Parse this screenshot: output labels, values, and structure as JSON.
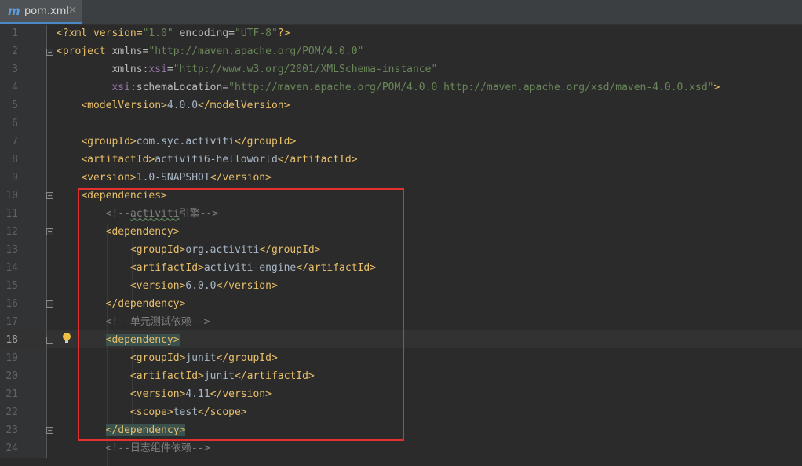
{
  "tab": {
    "icon": "m",
    "filename": "pom.xml",
    "close": "✕"
  },
  "accent_colors": {
    "tag": "#e8bf6a",
    "attribute_value": "#6a8759",
    "namespace": "#9876aa",
    "comment": "#808080",
    "highlight_box": "#e53030"
  },
  "gutter": {
    "line_numbers": [
      "1",
      "2",
      "3",
      "4",
      "5",
      "6",
      "7",
      "8",
      "9",
      "10",
      "11",
      "12",
      "13",
      "14",
      "15",
      "16",
      "17",
      "18",
      "19",
      "20",
      "21",
      "22",
      "23",
      "24"
    ],
    "current_line": "18",
    "icons": [
      "fold-icon",
      "intention-bulb-icon"
    ]
  },
  "code": {
    "l1": {
      "a": "<?xml version=",
      "b": "\"1.0\"",
      "c": " encoding=",
      "d": "\"UTF-8\"",
      "e": "?>"
    },
    "l2": {
      "a": "<project ",
      "b": "xmlns=",
      "c": "\"http://maven.apache.org/POM/4.0.0\""
    },
    "l3": {
      "a": "xmlns:",
      "b": "xsi",
      "c": "=",
      "d": "\"http://www.w3.org/2001/XMLSchema-instance\""
    },
    "l4": {
      "a": "xsi",
      "b": ":schemaLocation=",
      "c": "\"http://maven.apache.org/POM/4.0.0 http://maven.apache.org/xsd/maven-4.0.0.xsd\"",
      "d": ">"
    },
    "l5": {
      "a": "<modelVersion>",
      "b": "4.0.0",
      "c": "</modelVersion>"
    },
    "l7": {
      "a": "<groupId>",
      "b": "com.syc.activiti",
      "c": "</groupId>"
    },
    "l8": {
      "a": "<artifactId>",
      "b": "activiti6-helloworld",
      "c": "</artifactId>"
    },
    "l9": {
      "a": "<version>",
      "b": "1.0-SNAPSHOT",
      "c": "</version>"
    },
    "l10": {
      "a": "<dependencies>"
    },
    "l11": {
      "a": "<!--",
      "b": "activiti",
      "c": "引擎-->"
    },
    "l12": {
      "a": "<dependency>"
    },
    "l13": {
      "a": "<groupId>",
      "b": "org.activiti",
      "c": "</groupId>"
    },
    "l14": {
      "a": "<artifactId>",
      "b": "activiti-engine",
      "c": "</artifactId>"
    },
    "l15": {
      "a": "<version>",
      "b": "6.0.0",
      "c": "</version>"
    },
    "l16": {
      "a": "</dependency>"
    },
    "l17": {
      "a": "<!--单元测试依赖-->"
    },
    "l18": {
      "a": "<dependency>"
    },
    "l19": {
      "a": "<groupId>",
      "b": "junit",
      "c": "</groupId>"
    },
    "l20": {
      "a": "<artifactId>",
      "b": "junit",
      "c": "</artifactId>"
    },
    "l21": {
      "a": "<version>",
      "b": "4.11",
      "c": "</version>"
    },
    "l22": {
      "a": "<scope>",
      "b": "test",
      "c": "</scope>"
    },
    "l23": {
      "a": "</dependency>"
    },
    "l24": {
      "a": "<!--日志组件依赖-->"
    }
  }
}
